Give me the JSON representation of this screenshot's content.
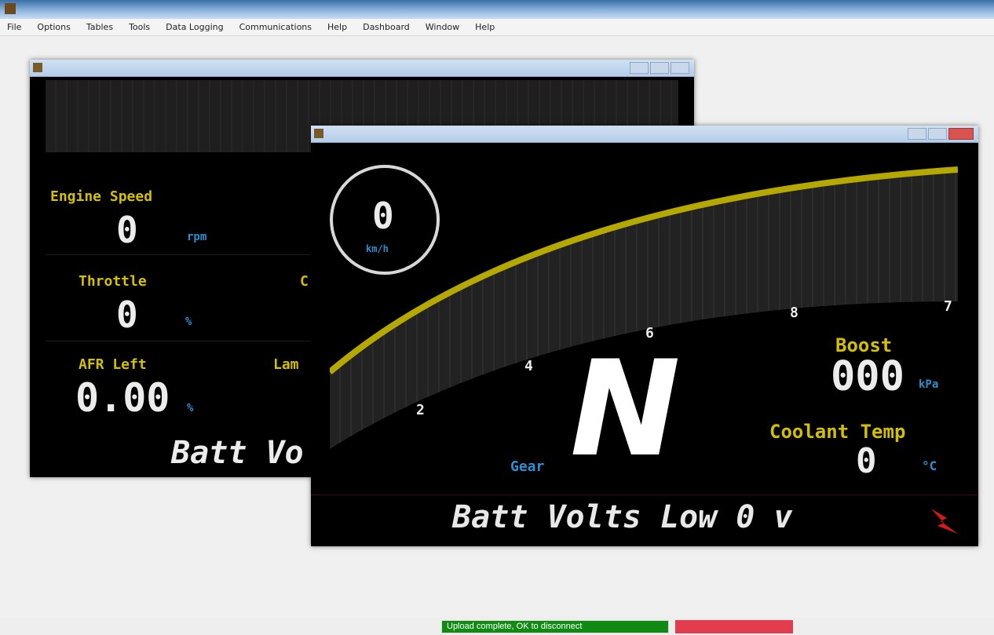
{
  "app": {
    "title": "",
    "menu": [
      "File",
      "Options",
      "Tables",
      "Tools",
      "Data Logging",
      "Communications",
      "Help",
      "Dashboard",
      "Window",
      "Help"
    ]
  },
  "back_window": {
    "title": "",
    "engine_speed_label": "Engine Speed",
    "engine_speed_value": "0",
    "engine_speed_unit": "rpm",
    "throttle_label": "Throttle",
    "throttle_value": "0",
    "throttle_unit": "%",
    "afr_label": "AFR Left",
    "afr_value": "0.00",
    "afr_unit": "%",
    "lambda_label_partial": "Lam",
    "cut_label_partial": "C",
    "batt_partial": "Batt Vo"
  },
  "front_window": {
    "title": "",
    "speed_value": "0",
    "speed_unit": "km/h",
    "tick_labels": [
      "2",
      "4",
      "6",
      "8",
      "7"
    ],
    "gear_label": "Gear",
    "gear_value": "N",
    "boost_label": "Boost",
    "boost_value": "000",
    "boost_unit": "kPa",
    "coolant_label": "Coolant Temp",
    "coolant_value": "0",
    "coolant_unit": "°C",
    "message": "Batt Volts Low 0 v",
    "icon_alert": "alert-icon",
    "rpm_bar_level": 0.0
  },
  "status": {
    "message": "Upload complete, OK to disconnect"
  },
  "colors": {
    "label_yellow": "#d4c000",
    "unit_blue": "#2c8fd0",
    "status_green": "#118a14",
    "alert_red": "#e33c4f"
  }
}
